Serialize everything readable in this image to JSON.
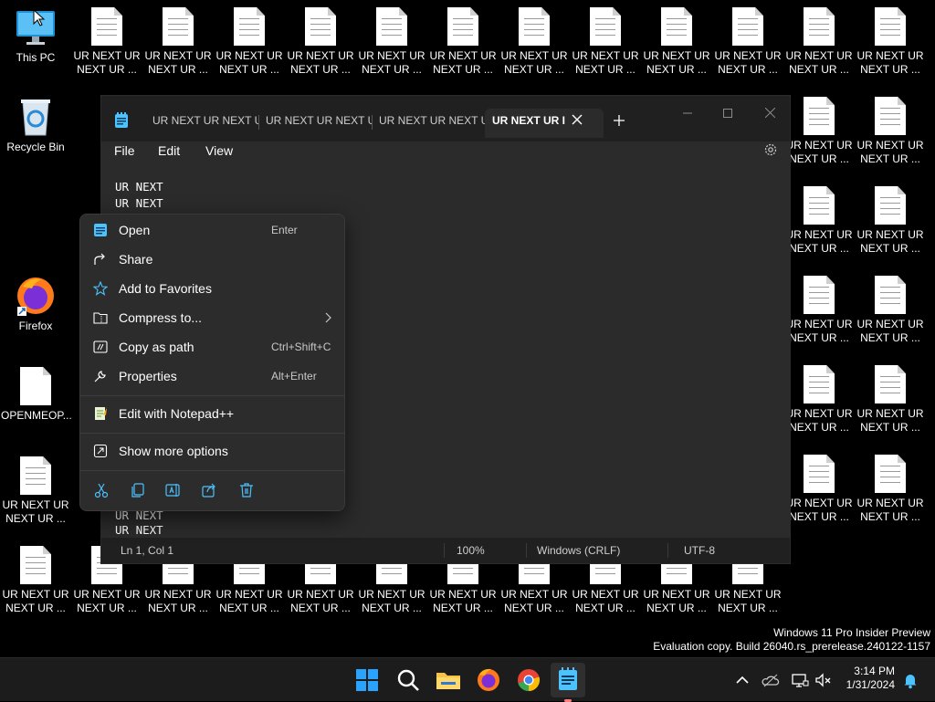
{
  "desktop": {
    "this_pc": "This PC",
    "recycle_bin": "Recycle Bin",
    "firefox": "Firefox",
    "openmeop": "OPENMEOP...",
    "file_label_1": "UR NEXT UR",
    "file_label_2": "NEXT UR ..."
  },
  "notepad": {
    "tabs": [
      "UR NEXT UR NEXT U",
      "UR NEXT UR NEXT U",
      "UR NEXT UR NEXT U",
      "UR NEXT UR I"
    ],
    "menu": {
      "file": "File",
      "edit": "Edit",
      "view": "View"
    },
    "lines": [
      "UR NEXT",
      "UR NEXT",
      "UR NEXT",
      "UR NEXT"
    ],
    "status": {
      "position": "Ln 1, Col 1",
      "zoom": "100%",
      "line_ending": "Windows (CRLF)",
      "encoding": "UTF-8"
    }
  },
  "context_menu": {
    "open": "Open",
    "open_key": "Enter",
    "share": "Share",
    "favorites": "Add to Favorites",
    "compress": "Compress to...",
    "copy_path": "Copy as path",
    "copy_path_key": "Ctrl+Shift+C",
    "properties": "Properties",
    "properties_key": "Alt+Enter",
    "notepadpp": "Edit with Notepad++",
    "more": "Show more options"
  },
  "watermark": {
    "line1": "Windows 11 Pro Insider Preview",
    "line2": "Evaluation copy. Build 26040.rs_prerelease.240122-1157"
  },
  "taskbar": {
    "time": "3:14 PM",
    "date": "1/31/2024"
  },
  "colors": {
    "accent": "#4cc2ff",
    "desktop": "#000000",
    "window": "#202020",
    "menu": "#2c2c2c"
  }
}
